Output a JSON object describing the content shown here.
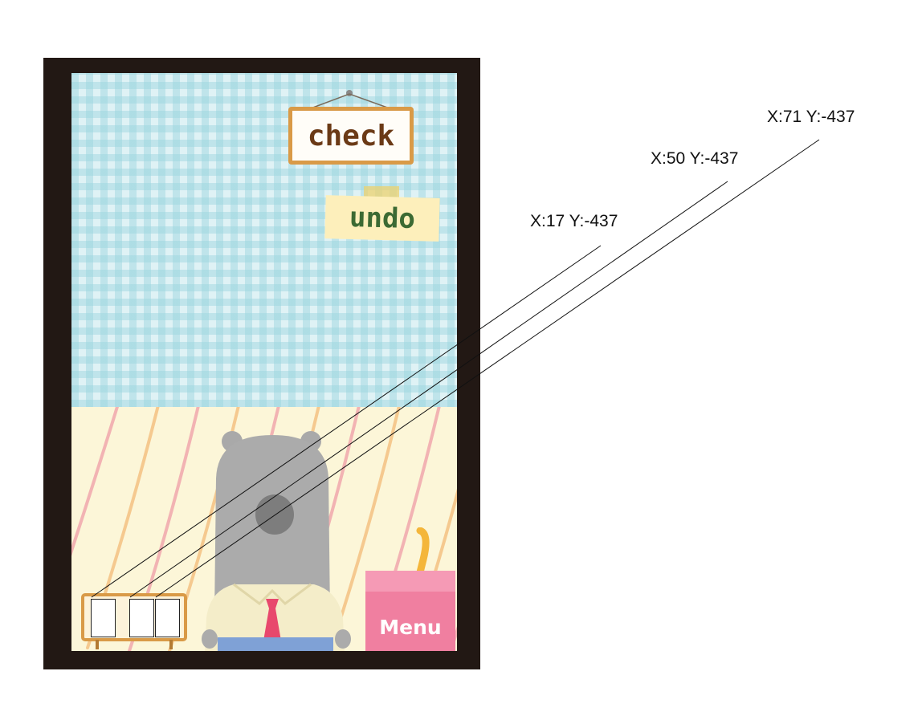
{
  "buttons": {
    "check_label": "check",
    "undo_label": "undo",
    "menu_label": "Menu"
  },
  "answer_slots": [
    {
      "value": ""
    },
    {
      "value": ""
    },
    {
      "value": ""
    }
  ],
  "coordinate_labels": [
    "X:17 Y:-437",
    "X:50 Y:-437",
    "X:71 Y:-437"
  ],
  "colors": {
    "frame": "#221814",
    "wall": "#dff2f5",
    "floor": "#fcf6d8",
    "sign_text": "#6b3a16",
    "undo_text": "#3c6a33",
    "menu_box": "#f07fa0"
  }
}
